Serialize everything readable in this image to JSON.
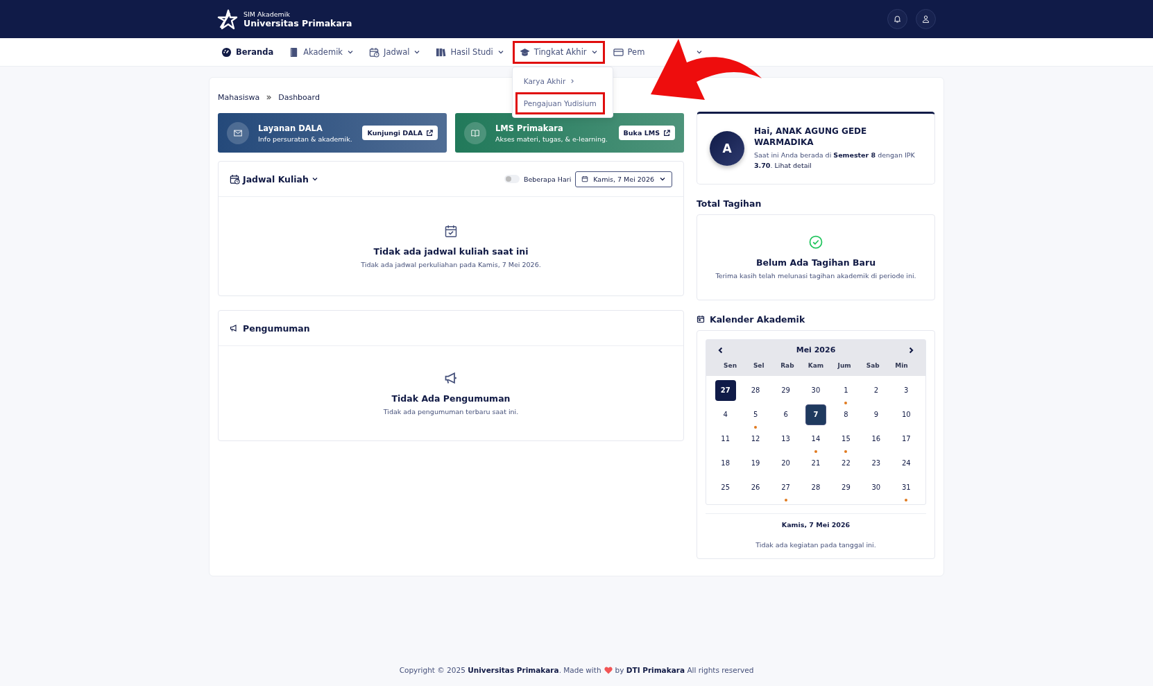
{
  "header": {
    "subtitle": "SIM Akademik",
    "title": "Universitas Primakara"
  },
  "nav": [
    {
      "label": "Beranda",
      "selected": true,
      "annotated": false,
      "caret": false
    },
    {
      "label": "Akademik",
      "selected": false,
      "annotated": false,
      "caret": true
    },
    {
      "label": "Jadwal",
      "selected": false,
      "annotated": false,
      "caret": true
    },
    {
      "label": "Hasil Studi",
      "selected": false,
      "annotated": false,
      "caret": true
    },
    {
      "label": "Tingkat Akhir",
      "selected": false,
      "annotated": true,
      "caret": true
    },
    {
      "label": "Pem",
      "selected": false,
      "annotated": false,
      "caret": true
    }
  ],
  "dropdown": {
    "items": [
      {
        "label": "Karya Akhir",
        "submenu": true,
        "annotated": false
      },
      {
        "label": "Pengajuan Yudisium",
        "submenu": false,
        "annotated": true
      }
    ]
  },
  "breadcrumb": [
    "Mahasiswa",
    "Dashboard"
  ],
  "banners": [
    {
      "kind": "mail",
      "title": "Layanan DALA",
      "text": "Info persuratan & akademik.",
      "button": "Kunjungi DALA",
      "color": "#24497a"
    },
    {
      "kind": "book",
      "title": "LMS Primakara",
      "text": "Akses materi, tugas, & e-learning.",
      "button": "Buka LMS",
      "color": "#21795a"
    }
  ],
  "schedule": {
    "title": "Jadwal Kuliah",
    "toggle": {
      "label": "Beberapa Hari",
      "on": false
    },
    "date": "Kamis, 7 Mei 2026",
    "empty_title": "Tidak ada jadwal kuliah saat ini",
    "empty_text": "Tidak ada jadwal perkuliahan pada Kamis, 7 Mei 2026."
  },
  "announcements": {
    "title": "Pengumuman",
    "empty_title": "Tidak Ada Pengumuman",
    "empty_text": "Tidak ada pengumuman terbaru saat ini."
  },
  "profile": {
    "initial": "A",
    "greeting": "Hai, ANAK AGUNG GEDE WARMADIKA",
    "text": "Saat ini Anda berada di **Semester 8** dengan IPK **3.70**.",
    "link": "Lihat detail"
  },
  "billing": {
    "title": "Total Tagihan",
    "empty_title": "Belum Ada Tagihan Baru",
    "empty_text": "Terima kasih telah melunasi tagihan akademik di periode ini."
  },
  "calendar": {
    "title": "Kalender Akademik",
    "month": "Mei 2026",
    "weekdays": [
      "Sen",
      "Sel",
      "Rab",
      "Kam",
      "Jum",
      "Sab",
      "Min"
    ],
    "days": [
      {
        "label": "27",
        "selected": false,
        "today": true,
        "event": false
      },
      {
        "label": "28",
        "selected": false,
        "today": false,
        "event": false
      },
      {
        "label": "29",
        "selected": false,
        "today": false,
        "event": false
      },
      {
        "label": "30",
        "selected": false,
        "today": false,
        "event": false
      },
      {
        "label": "1",
        "selected": false,
        "today": false,
        "event": true
      },
      {
        "label": "2",
        "selected": false,
        "today": false,
        "event": false
      },
      {
        "label": "3",
        "selected": false,
        "today": false,
        "event": false
      },
      {
        "label": "4",
        "selected": false,
        "today": false,
        "event": false
      },
      {
        "label": "5",
        "selected": false,
        "today": false,
        "event": true
      },
      {
        "label": "6",
        "selected": false,
        "today": false,
        "event": false
      },
      {
        "label": "7",
        "selected": true,
        "today": false,
        "event": false
      },
      {
        "label": "8",
        "selected": false,
        "today": false,
        "event": false
      },
      {
        "label": "9",
        "selected": false,
        "today": false,
        "event": false
      },
      {
        "label": "10",
        "selected": false,
        "today": false,
        "event": false
      },
      {
        "label": "11",
        "selected": false,
        "today": false,
        "event": false
      },
      {
        "label": "12",
        "selected": false,
        "today": false,
        "event": false
      },
      {
        "label": "13",
        "selected": false,
        "today": false,
        "event": false
      },
      {
        "label": "14",
        "selected": false,
        "today": false,
        "event": true
      },
      {
        "label": "15",
        "selected": false,
        "today": false,
        "event": true
      },
      {
        "label": "16",
        "selected": false,
        "today": false,
        "event": false
      },
      {
        "label": "17",
        "selected": false,
        "today": false,
        "event": false
      },
      {
        "label": "18",
        "selected": false,
        "today": false,
        "event": false
      },
      {
        "label": "19",
        "selected": false,
        "today": false,
        "event": false
      },
      {
        "label": "20",
        "selected": false,
        "today": false,
        "event": false
      },
      {
        "label": "21",
        "selected": false,
        "today": false,
        "event": false
      },
      {
        "label": "22",
        "selected": false,
        "today": false,
        "event": false
      },
      {
        "label": "23",
        "selected": false,
        "today": false,
        "event": false
      },
      {
        "label": "24",
        "selected": false,
        "today": false,
        "event": false
      },
      {
        "label": "25",
        "selected": false,
        "today": false,
        "event": false
      },
      {
        "label": "26",
        "selected": false,
        "today": false,
        "event": false
      },
      {
        "label": "27",
        "selected": false,
        "today": false,
        "event": true
      },
      {
        "label": "28",
        "selected": false,
        "today": false,
        "event": false
      },
      {
        "label": "29",
        "selected": false,
        "today": false,
        "event": false
      },
      {
        "label": "30",
        "selected": false,
        "today": false,
        "event": false
      },
      {
        "label": "31",
        "selected": false,
        "today": false,
        "event": true
      }
    ],
    "selected_date": "Kamis, 7 Mei 2026",
    "empty_text": "Tidak ada kegiatan pada tanggal ini."
  },
  "footer": {
    "before": "Copyright © 2025 **Universitas Primakara**. Made with",
    "after": "by **DTI Primakara** All rights reserved"
  }
}
